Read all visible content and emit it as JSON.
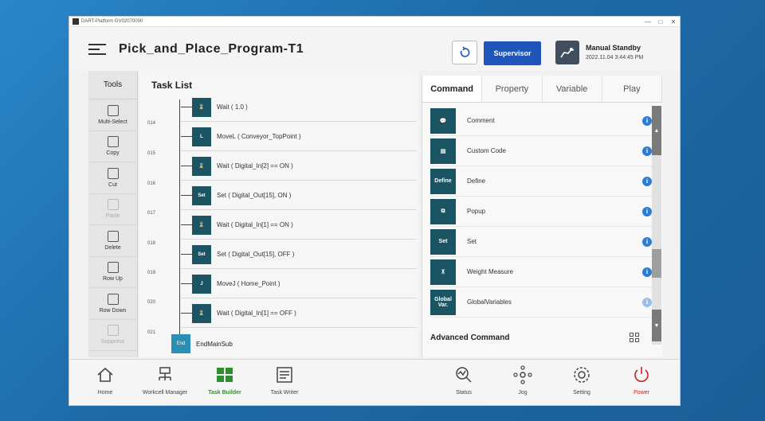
{
  "window": {
    "titlebar_text": "DART-Platform GV02070000",
    "controls": [
      "—",
      "□",
      "✕"
    ]
  },
  "header": {
    "title": "Pick_and_Place_Program-T1",
    "supervisor_label": "Supervisor",
    "status_mode": "Manual Standby",
    "status_datetime": "2022.11.04 3:44:45 PM"
  },
  "tools": {
    "header": "Tools",
    "items": [
      {
        "label": "Multi-Select",
        "enabled": true
      },
      {
        "label": "Copy",
        "enabled": true
      },
      {
        "label": "Cut",
        "enabled": true
      },
      {
        "label": "Paste",
        "enabled": false
      },
      {
        "label": "Delete",
        "enabled": true
      },
      {
        "label": "Row Up",
        "enabled": true
      },
      {
        "label": "Row Down",
        "enabled": true
      },
      {
        "label": "Suppress",
        "enabled": false
      }
    ]
  },
  "tasklist": {
    "header": "Task List",
    "line_numbers": [
      "014",
      "015",
      "016",
      "017",
      "018",
      "019",
      "020",
      "021"
    ],
    "rows": [
      {
        "icon": "wait-icon",
        "icon_text": "⌛",
        "text": "Wait  ( 1.0 )"
      },
      {
        "icon": "movel-icon",
        "icon_text": "L",
        "text": "MoveL  ( Conveyor_TopPoint )"
      },
      {
        "icon": "wait-icon",
        "icon_text": "⌛",
        "text": "Wait  ( Digital_In[2] == ON )"
      },
      {
        "icon": "set-icon",
        "icon_text": "Set",
        "text": "Set  ( Digital_Out[15], ON )"
      },
      {
        "icon": "wait-icon",
        "icon_text": "⌛",
        "text": "Wait  ( Digital_In[1] == ON )"
      },
      {
        "icon": "set-icon",
        "icon_text": "Set",
        "text": "Set  ( Digital_Out[15], OFF )"
      },
      {
        "icon": "movej-icon",
        "icon_text": "J",
        "text": "MoveJ  ( Home_Point )"
      },
      {
        "icon": "wait-icon",
        "icon_text": "⌛",
        "text": "Wait  ( Digital_In[1] == OFF )"
      }
    ],
    "end_row": {
      "icon_text": "End",
      "text": "EndMainSub"
    }
  },
  "right_panel": {
    "tabs": [
      "Command",
      "Property",
      "Variable",
      "Play"
    ],
    "active_tab": "Command",
    "commands": [
      {
        "icon": "comment-icon",
        "icon_text": "💬",
        "label": "Comment"
      },
      {
        "icon": "custom-code-icon",
        "icon_text": "▤",
        "label": "Custom Code"
      },
      {
        "icon": "define-icon",
        "icon_text": "Define",
        "label": "Define"
      },
      {
        "icon": "popup-icon",
        "icon_text": "⧉",
        "label": "Popup"
      },
      {
        "icon": "set-icon",
        "icon_text": "Set",
        "label": "Set"
      },
      {
        "icon": "weight-measure-icon",
        "icon_text": "⊼",
        "label": "Weight Measure"
      },
      {
        "icon": "global-variables-icon",
        "icon_text": "Global Var.",
        "label": "GlobalVariables"
      }
    ],
    "advanced_header": "Advanced Command"
  },
  "bottom_nav": [
    {
      "label": "Home",
      "icon": "home-icon"
    },
    {
      "label": "Workcell Manager",
      "icon": "workcell-icon"
    },
    {
      "label": "Task Builder",
      "icon": "task-builder-icon",
      "active": true
    },
    {
      "label": "Task Writer",
      "icon": "task-writer-icon"
    },
    {
      "label": "Status",
      "icon": "status-icon"
    },
    {
      "label": "Jog",
      "icon": "jog-icon"
    },
    {
      "label": "Setting",
      "icon": "gear-icon"
    },
    {
      "label": "Power",
      "icon": "power-icon"
    }
  ],
  "colors": {
    "accent_blue": "#1f55b8",
    "icon_teal": "#1b5563",
    "active_green": "#2f8f2f",
    "power_red": "#cc2222"
  }
}
